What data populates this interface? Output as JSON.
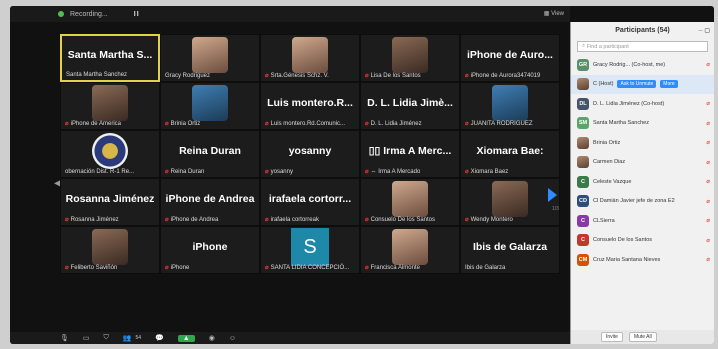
{
  "topbar": {
    "status": "Recording...",
    "pause": "II",
    "view": "View"
  },
  "tiles": [
    {
      "big": "Santa Martha S...",
      "cap": "Santa Martha Sanchez",
      "muted": false,
      "active": true
    },
    {
      "big": "",
      "cap": "Gracy Rodriguez",
      "muted": false,
      "face": "light"
    },
    {
      "big": "",
      "cap": "Srta.Génesis Schz. V.",
      "muted": true,
      "face": "light"
    },
    {
      "big": "",
      "cap": "Lisa De los Santos",
      "muted": true,
      "face": "dark"
    },
    {
      "big": "iPhone de Auro...",
      "cap": "iPhone de Aurora3474019",
      "muted": true
    },
    {
      "big": "",
      "cap": "iPhone de America",
      "muted": true,
      "face": "dark"
    },
    {
      "big": "",
      "cap": "Brinia Ortiz",
      "muted": true,
      "face": "blue"
    },
    {
      "big": "Luis montero.R...",
      "cap": "Luis montero.Rd.Comunic...",
      "muted": true
    },
    {
      "big": "D. L. Lidia Jimè...",
      "cap": "D. L. Lidia Jiménez",
      "muted": true
    },
    {
      "big": "",
      "cap": "JUANITA RODRIGUEZ",
      "muted": true,
      "face": "blue"
    },
    {
      "big": "",
      "cap": "obernación Dist. R-1 Re...",
      "muted": false,
      "face": "gold"
    },
    {
      "big": "Reina Duran",
      "cap": "Reina Duran",
      "muted": true
    },
    {
      "big": "yosanny",
      "cap": "yosanny",
      "muted": true
    },
    {
      "big": "▯▯ Irma A Merc...",
      "cap": "⇔ Irma A Mercado",
      "muted": true
    },
    {
      "big": "Xiomara Bae:",
      "cap": "Xiomara Baez",
      "muted": true
    },
    {
      "big": "Rosanna Jiménez",
      "cap": "Rosanna Jiménez",
      "muted": true
    },
    {
      "big": "iPhone de Andrea",
      "cap": "iPhone de Andrea",
      "muted": true
    },
    {
      "big": "irafaela cortorr...",
      "cap": "irafaela cortorreak",
      "muted": true
    },
    {
      "big": "",
      "cap": "Consuelo De los Santos",
      "muted": true,
      "face": "light"
    },
    {
      "big": "",
      "cap": "Wendy Montero",
      "muted": true,
      "face": "dark"
    },
    {
      "big": "",
      "cap": "Feliberto Saviñón",
      "muted": true,
      "face": "dark"
    },
    {
      "big": "iPhone",
      "cap": "iPhone",
      "muted": true
    },
    {
      "big": "S",
      "cap": "SANTA LIDIA CONCEPCIÓ...",
      "muted": true,
      "avatar": true
    },
    {
      "big": "",
      "cap": "Francisca Almonte",
      "muted": true,
      "face": "light"
    },
    {
      "big": "Ibis de Galarza",
      "cap": "Ibis de Galarza",
      "muted": false
    }
  ],
  "pager": {
    "indicator": "1/3"
  },
  "toolbar": {
    "participants_count": "54",
    "share_label": "▲"
  },
  "panel": {
    "title": "Participants (54)",
    "search_placeholder": "Find a participant",
    "unmute_label": "Ask to Unmute",
    "more_label": "More",
    "participants": [
      {
        "initials": "GR",
        "color": "#5a8f6a",
        "name": "Gracy Rodrig... (Co-host, me)"
      },
      {
        "initials": "",
        "color": "",
        "name": "C (Host)",
        "host": true,
        "photo": true
      },
      {
        "initials": "DL",
        "color": "#44546a",
        "name": "D. L. Lidia Jiménez (Co-host)"
      },
      {
        "initials": "SM",
        "color": "#5aa469",
        "name": "Santa Martha Sanchez"
      },
      {
        "initials": "",
        "color": "",
        "name": "Brinia Ortiz",
        "photo": true
      },
      {
        "initials": "",
        "color": "",
        "name": "Carmen Diaz",
        "photo": true
      },
      {
        "initials": "C",
        "color": "#3a7a4a",
        "name": "Celeste Vazque"
      },
      {
        "initials": "CD",
        "color": "#2d4d7a",
        "name": "Cl Damián Javier jefe de zona E2"
      },
      {
        "initials": "C",
        "color": "#8a3aa8",
        "name": "CLSierra"
      },
      {
        "initials": "C",
        "color": "#c0392b",
        "name": "Consuelo De los Santos"
      },
      {
        "initials": "CM",
        "color": "#d35400",
        "name": "Cruz Maria Santana Nieves"
      }
    ],
    "invite_label": "Invite",
    "mute_all_label": "Mute All"
  }
}
